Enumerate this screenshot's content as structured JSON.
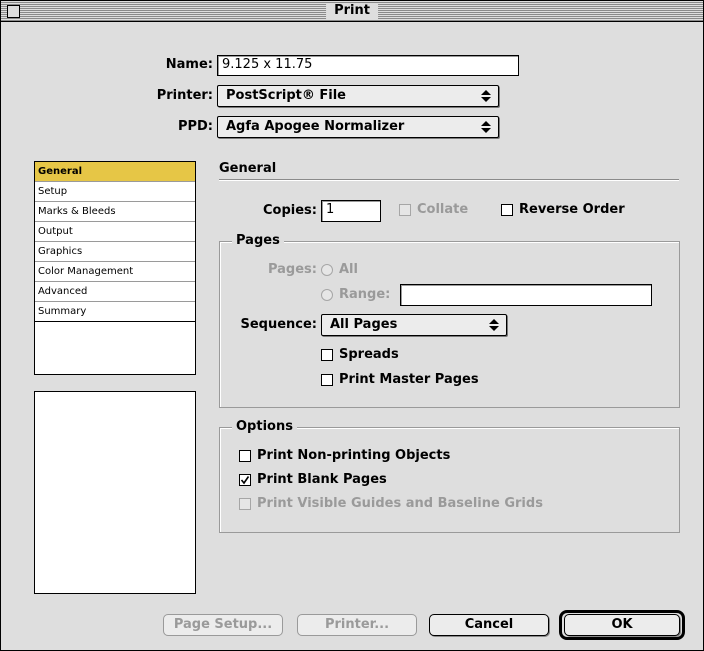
{
  "window": {
    "title": "Print"
  },
  "form": {
    "name_label": "Name:",
    "name_value": "9.125 x 11.75",
    "printer_label": "Printer:",
    "printer_value": "PostScript® File",
    "ppd_label": "PPD:",
    "ppd_value": "Agfa Apogee Normalizer"
  },
  "sidebar": {
    "items": [
      {
        "label": "General",
        "selected": true
      },
      {
        "label": "Setup"
      },
      {
        "label": "Marks & Bleeds"
      },
      {
        "label": "Output"
      },
      {
        "label": "Graphics"
      },
      {
        "label": "Color Management"
      },
      {
        "label": "Advanced"
      },
      {
        "label": "Summary"
      }
    ]
  },
  "panel": {
    "heading": "General",
    "copies_label": "Copies:",
    "copies_value": "1",
    "collate_label": "Collate",
    "collate_checked": false,
    "collate_enabled": false,
    "reverse_label": "Reverse Order",
    "reverse_checked": false
  },
  "pages_group": {
    "legend": "Pages",
    "pages_label": "Pages:",
    "all_label": "All",
    "range_label": "Range:",
    "range_value": "",
    "sequence_label": "Sequence:",
    "sequence_value": "All Pages",
    "spreads_label": "Spreads",
    "spreads_checked": false,
    "master_label": "Print Master Pages",
    "master_checked": false
  },
  "options_group": {
    "legend": "Options",
    "nonprinting_label": "Print Non-printing Objects",
    "nonprinting_checked": false,
    "blank_label": "Print Blank Pages",
    "blank_checked": true,
    "guides_label": "Print Visible Guides and Baseline Grids",
    "guides_checked": false,
    "guides_enabled": false
  },
  "buttons": {
    "page_setup": "Page Setup...",
    "printer": "Printer...",
    "cancel": "Cancel",
    "ok": "OK"
  },
  "colors": {
    "selection": "#e6c646",
    "face": "#dedede"
  }
}
